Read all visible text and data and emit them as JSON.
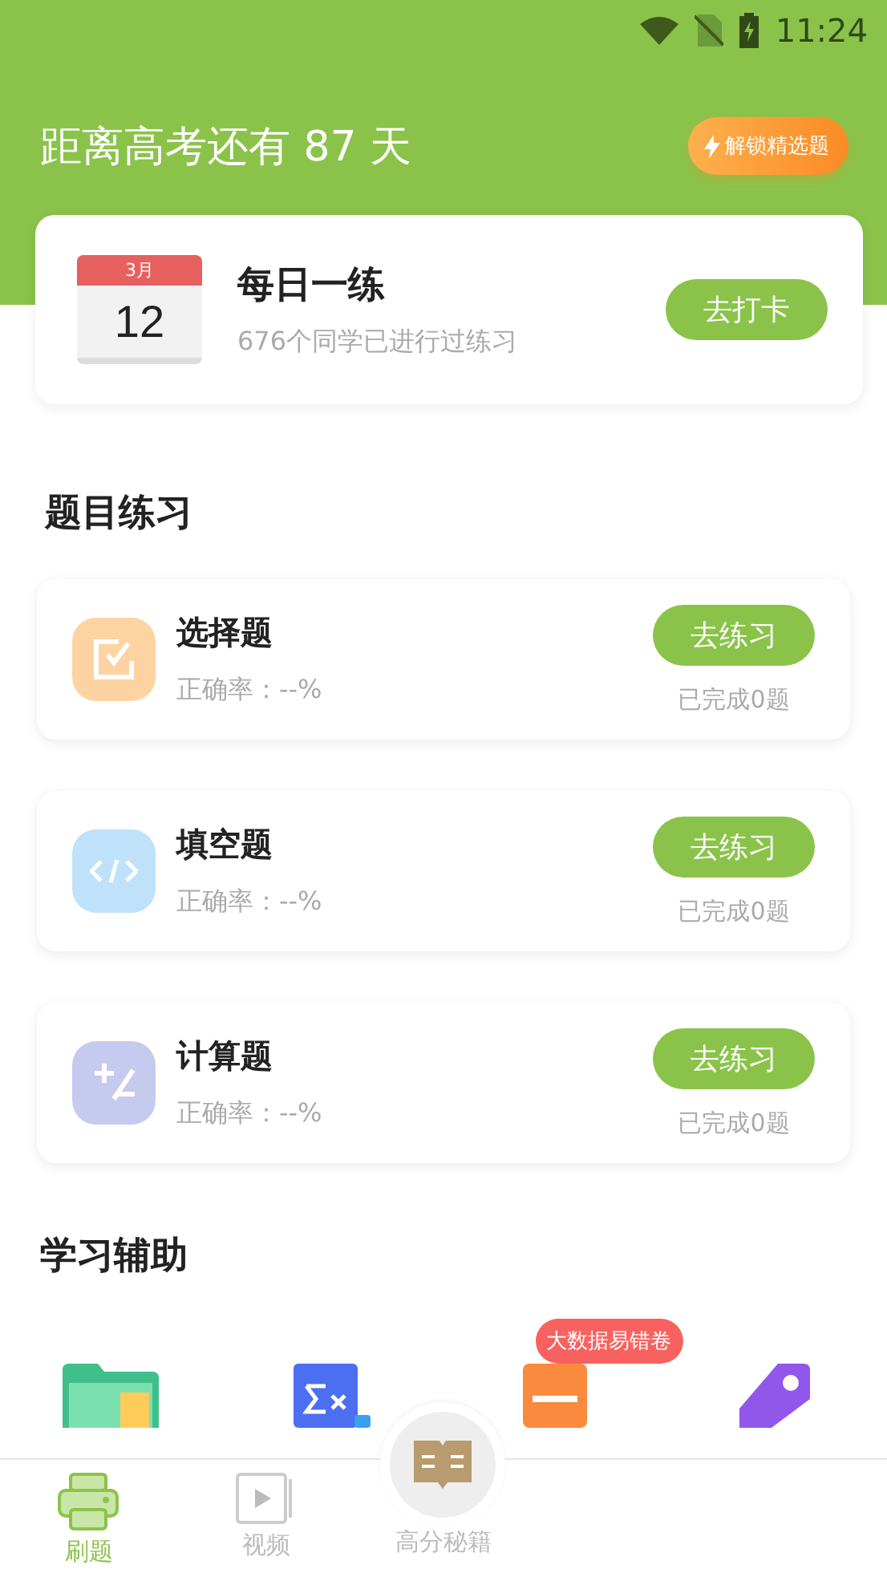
{
  "status_bar": {
    "time": "11:24"
  },
  "header": {
    "countdown": "距离高考还有 87 天",
    "unlock_button": "解锁精选题"
  },
  "daily": {
    "month": "3月",
    "day": "12",
    "title": "每日一练",
    "subtitle": "676个同学已进行过练习",
    "button": "去打卡"
  },
  "practice": {
    "title": "题目练习",
    "items": [
      {
        "kind": "choice",
        "name": "选择题",
        "accuracy": "正确率：--%",
        "button": "去练习",
        "completed": "已完成0题"
      },
      {
        "kind": "fill",
        "name": "填空题",
        "accuracy": "正确率：--%",
        "button": "去练习",
        "completed": "已完成0题"
      },
      {
        "kind": "calc",
        "name": "计算题",
        "accuracy": "正确率：--%",
        "button": "去练习",
        "completed": "已完成0题"
      }
    ]
  },
  "study_aids": {
    "title": "学习辅助",
    "tools": [
      {
        "kind": "folder"
      },
      {
        "kind": "formula"
      },
      {
        "kind": "paper",
        "badge": "大数据易错卷"
      },
      {
        "kind": "tag"
      }
    ]
  },
  "tab_bar": [
    {
      "kind": "print",
      "label": "刷题",
      "selected": true
    },
    {
      "kind": "video",
      "label": "视频",
      "selected": false
    },
    {
      "kind": "book",
      "label": "高分秘籍",
      "selected": false
    }
  ]
}
